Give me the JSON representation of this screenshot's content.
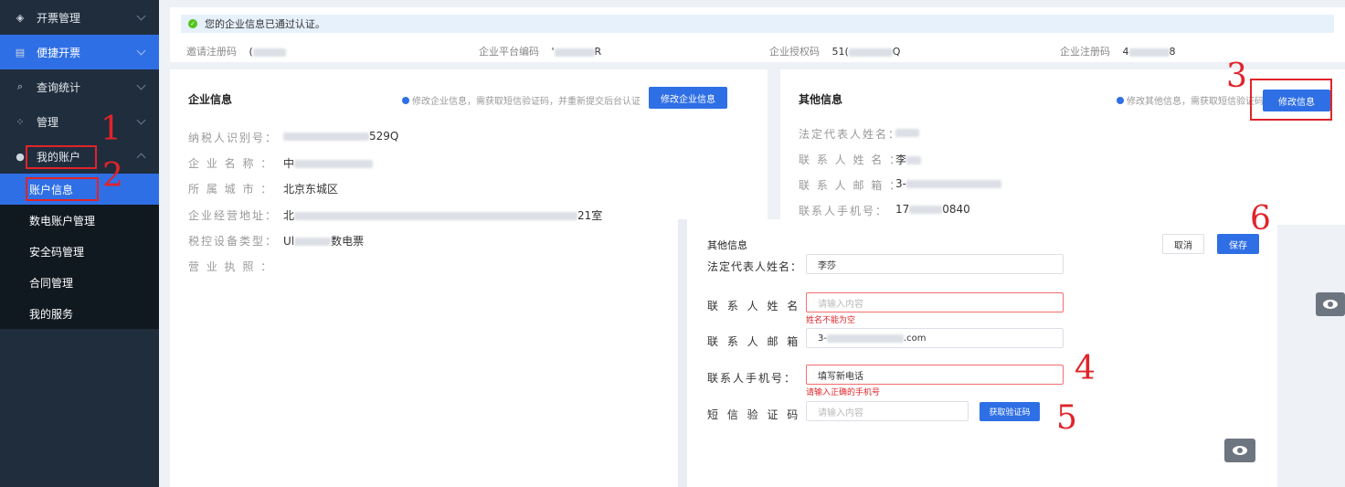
{
  "sidebar": {
    "items": [
      {
        "label": "开票管理",
        "icon": "diamond-icon"
      },
      {
        "label": "便捷开票",
        "icon": "document-icon"
      },
      {
        "label": "查询统计",
        "icon": "search-icon"
      },
      {
        "label": "管理",
        "icon": "grid-icon"
      },
      {
        "label": "我的账户",
        "icon": "user-icon"
      }
    ],
    "sub_items": [
      {
        "label": "账户信息"
      },
      {
        "label": "数电账户管理"
      },
      {
        "label": "安全码管理"
      },
      {
        "label": "合同管理"
      },
      {
        "label": "我的服务"
      }
    ]
  },
  "annotations": [
    "1",
    "2",
    "3",
    "4",
    "5",
    "6"
  ],
  "top": {
    "verified_text": "您的企业信息已通过认证。",
    "invite_label": "邀请注册码",
    "invite_value": "(",
    "platform_label": "企业平台编码",
    "platform_value_prefix": "'",
    "platform_value_suffix": "R",
    "auth_label": "企业授权码",
    "auth_value_prefix": "51(",
    "auth_value_suffix": "Q",
    "reg_label": "企业注册码",
    "reg_value_prefix": "4",
    "reg_value_suffix": "8"
  },
  "company": {
    "title": "企业信息",
    "hint": "修改企业信息，需获取短信验证码，并重新提交后台认证",
    "edit_button": "修改企业信息",
    "fields": [
      {
        "label": "纳税人识别号：",
        "value_prefix": "",
        "value_suffix": "529Q"
      },
      {
        "label": "企 业 名 称 ：",
        "value_prefix": "中",
        "value_suffix": ""
      },
      {
        "label": "所 属 城 市 ：",
        "value_prefix": "北京东城区",
        "value_suffix": ""
      },
      {
        "label": "企业经营地址：",
        "value_prefix": "北",
        "value_suffix": "21室"
      },
      {
        "label": "税控设备类型：",
        "value_prefix": "Ul",
        "value_suffix": "数电票"
      },
      {
        "label": "营 业 执 照 ：",
        "value_prefix": "",
        "value_suffix": ""
      }
    ]
  },
  "other": {
    "title": "其他信息",
    "hint": "修改其他信息，需获取短信验证码",
    "edit_button": "修改信息",
    "fields": [
      {
        "label": "法定代表人姓名：",
        "value_prefix": "",
        "value_suffix": ""
      },
      {
        "label": "联 系 人 姓 名 ：",
        "value_prefix": "李",
        "value_suffix": ""
      },
      {
        "label": "联 系 人 邮 箱 ：",
        "value_prefix": "3-",
        "value_suffix": ""
      },
      {
        "label": "联系人手机号：",
        "value_prefix": "17",
        "value_suffix": "0840"
      }
    ]
  },
  "form": {
    "title": "其他信息",
    "cancel": "取消",
    "save": "保存",
    "rows": [
      {
        "label": "法定代表人姓名：",
        "value": "李莎",
        "placeholder": "",
        "error": ""
      },
      {
        "label": "联 系 人 姓 名 ：",
        "value": "",
        "placeholder": "请输入内容",
        "error": "姓名不能为空"
      },
      {
        "label": "联 系 人 邮 箱 ：",
        "value_prefix": "3-",
        "value_suffix": ".com",
        "placeholder": "",
        "error": ""
      },
      {
        "label": "联系人手机号：",
        "value": "填写新电话",
        "placeholder": "",
        "error": "请输入正确的手机号"
      },
      {
        "label": "短 信 验 证 码 ：",
        "value": "",
        "placeholder": "请输入内容",
        "error": ""
      }
    ],
    "sms_button": "获取验证码"
  }
}
